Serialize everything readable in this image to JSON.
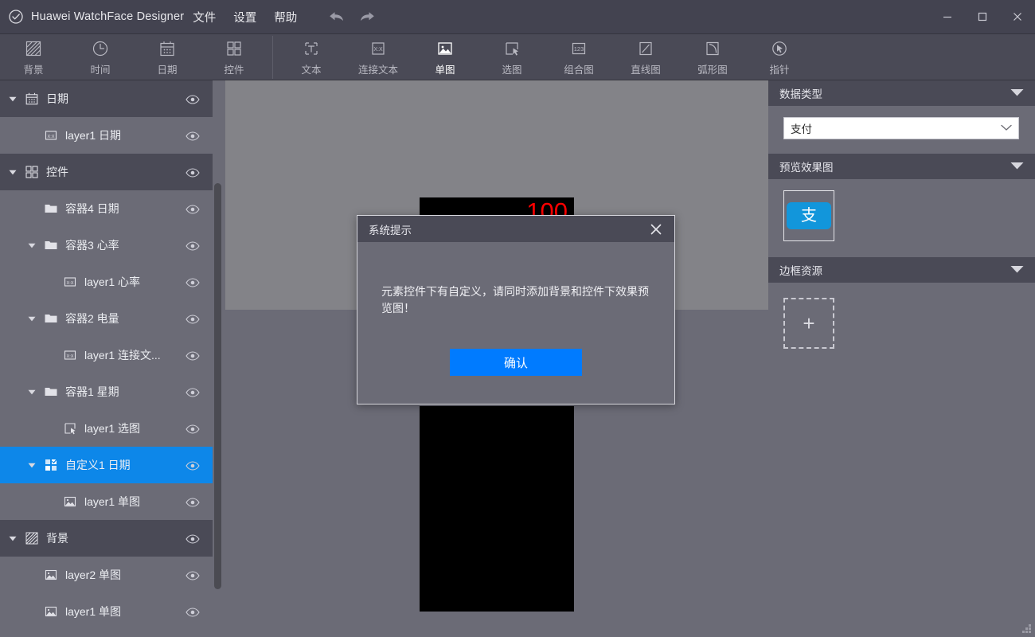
{
  "window": {
    "app_title": "Huawei WatchFace Designer",
    "logo_icon": "clock-check-icon",
    "menus": [
      {
        "label": "文件",
        "name": "menu-file"
      },
      {
        "label": "设置",
        "name": "menu-settings"
      },
      {
        "label": "帮助",
        "name": "menu-help"
      }
    ],
    "undo_icon": "undo-arrow-icon",
    "redo_icon": "redo-arrow-icon",
    "controls": {
      "minimize": "minimize-icon",
      "maximize": "maximize-icon",
      "close": "close-icon"
    }
  },
  "toolbar": {
    "groups": [
      [
        {
          "label": "背景",
          "icon": "hatched-square-icon",
          "active": false
        },
        {
          "label": "时间",
          "icon": "clock-icon",
          "active": false
        },
        {
          "label": "日期",
          "icon": "calendar-icon",
          "active": false
        },
        {
          "label": "控件",
          "icon": "widgets-grid-icon",
          "active": false
        }
      ],
      [
        {
          "label": "文本",
          "icon": "text-box-icon",
          "active": false
        },
        {
          "label": "连接文本",
          "icon": "linked-text-icon",
          "active": false
        },
        {
          "label": "单图",
          "icon": "single-image-icon",
          "active": true
        },
        {
          "label": "选图",
          "icon": "select-image-icon",
          "active": false
        },
        {
          "label": "组合图",
          "icon": "number-group-icon",
          "active": false
        },
        {
          "label": "直线图",
          "icon": "line-shape-icon",
          "active": false
        },
        {
          "label": "弧形图",
          "icon": "arc-shape-icon",
          "active": false
        },
        {
          "label": "指针",
          "icon": "pointer-hand-icon",
          "active": false
        }
      ]
    ]
  },
  "layers": [
    {
      "label": "日期",
      "icon": "calendar-icon",
      "type": "group",
      "indent": 0,
      "caret": "down",
      "selected": false,
      "eye": true
    },
    {
      "label": "layer1 日期",
      "icon": "text-field-icon",
      "type": "layer",
      "indent": 1,
      "caret": "none",
      "selected": false,
      "eye": true
    },
    {
      "label": "控件",
      "icon": "widgets-grid-icon",
      "type": "group",
      "indent": 0,
      "caret": "down",
      "selected": false,
      "eye": true
    },
    {
      "label": "容器4 日期",
      "icon": "folder-icon",
      "type": "layer",
      "indent": 1,
      "caret": "none",
      "selected": false,
      "eye": true
    },
    {
      "label": "容器3 心率",
      "icon": "folder-icon",
      "type": "layer",
      "indent": 1,
      "caret": "down",
      "selected": false,
      "eye": true
    },
    {
      "label": "layer1 心率",
      "icon": "text-field-icon",
      "type": "layer",
      "indent": 2,
      "caret": "none",
      "selected": false,
      "eye": true
    },
    {
      "label": "容器2 电量",
      "icon": "folder-icon",
      "type": "layer",
      "indent": 1,
      "caret": "down",
      "selected": false,
      "eye": true
    },
    {
      "label": "layer1 连接文...",
      "icon": "text-field-icon",
      "type": "layer",
      "indent": 2,
      "caret": "none",
      "selected": false,
      "eye": true
    },
    {
      "label": "容器1 星期",
      "icon": "folder-icon",
      "type": "layer",
      "indent": 1,
      "caret": "down",
      "selected": false,
      "eye": true
    },
    {
      "label": "layer1 选图",
      "icon": "select-image-icon",
      "type": "layer",
      "indent": 2,
      "caret": "none",
      "selected": false,
      "eye": true
    },
    {
      "label": "自定义1 日期",
      "icon": "custom-widget-icon",
      "type": "layer",
      "indent": 1,
      "caret": "down",
      "selected": true,
      "eye": true
    },
    {
      "label": "layer1 单图",
      "icon": "image-icon",
      "type": "layer",
      "indent": 2,
      "caret": "none",
      "selected": false,
      "eye": true
    },
    {
      "label": "背景",
      "icon": "hatched-square-icon",
      "type": "group",
      "indent": 0,
      "caret": "down",
      "selected": false,
      "eye": true
    },
    {
      "label": "layer2 单图",
      "icon": "image-icon",
      "type": "layer",
      "indent": 1,
      "caret": "none",
      "selected": false,
      "eye": true
    },
    {
      "label": "layer1 单图",
      "icon": "image-icon",
      "type": "layer",
      "indent": 1,
      "caret": "none",
      "selected": false,
      "eye": true
    }
  ],
  "canvas": {
    "top_value": "100",
    "top_value_color": "#ff0000",
    "element_fill": "#000000",
    "upper_bg": "#838388",
    "lower_bg": "#6b6b76"
  },
  "right_panel": {
    "sections": [
      {
        "title": "数据类型",
        "name": "section-data-type"
      },
      {
        "title": "预览效果图",
        "name": "section-preview"
      },
      {
        "title": "边框资源",
        "name": "section-border-resource"
      }
    ],
    "data_type": {
      "selected": "支付",
      "placeholder": "支付"
    },
    "preview": {
      "thumb_glyph": "支",
      "thumb_color": "#1296db"
    },
    "border_resource": {
      "add_label": "+"
    }
  },
  "modal": {
    "title": "系统提示",
    "message": "元素控件下有自定义，请同时添加背景和控件下效果预览图！",
    "confirm_label": "确认",
    "close_icon": "close-icon",
    "accent": "#007bff"
  }
}
